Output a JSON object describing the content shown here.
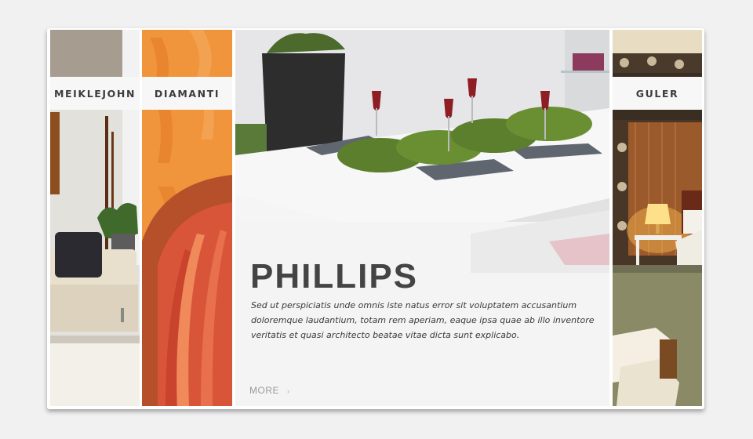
{
  "panels": [
    {
      "label": "MEIKLEJOHN"
    },
    {
      "label": "DIAMANTI"
    },
    {
      "title": "PHILLIPS",
      "description": "Sed ut perspiciatis unde omnis iste natus error sit voluptatem accusantium doloremque laudantium, totam rem aperiam, eaque ipsa quae ab illo inventore veritatis et quasi architecto beatae vitae dicta sunt explicabo.",
      "more_label": "MORE",
      "more_arrow": "›"
    },
    {
      "label": "GULER"
    }
  ],
  "colors": {
    "accent_orange": "#f0953c",
    "label_text": "#3c3c3c",
    "title_text": "#444444"
  }
}
